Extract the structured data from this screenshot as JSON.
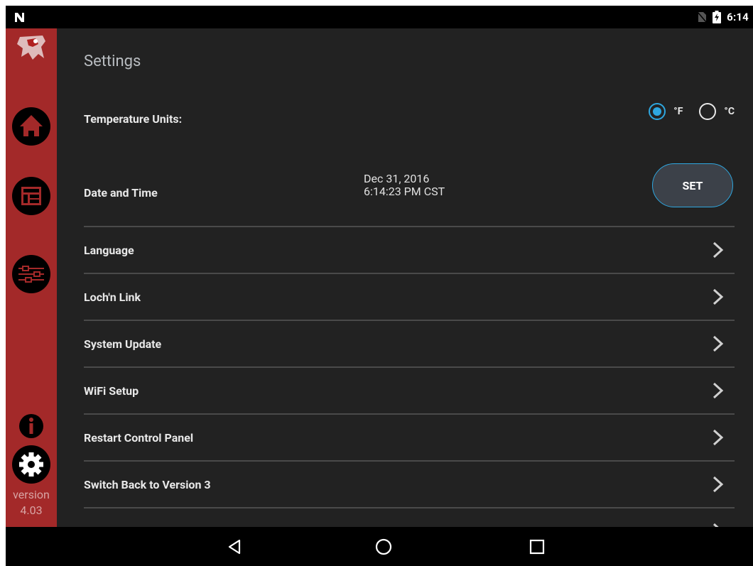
{
  "status_bar": {
    "time": "6:14",
    "icons": [
      "n-logo-icon",
      "no-sim-icon",
      "battery-charging-icon"
    ]
  },
  "sidebar": {
    "items": [
      {
        "icon": "logo-icon"
      },
      {
        "icon": "home-icon"
      },
      {
        "icon": "dashboard-icon"
      },
      {
        "icon": "sliders-icon"
      },
      {
        "icon": "info-icon"
      },
      {
        "icon": "gear-icon"
      }
    ],
    "version_label": "version",
    "version_number": "4.03"
  },
  "settings": {
    "title": "Settings",
    "temperature": {
      "label": "Temperature Units:",
      "options": [
        "°F",
        "°C"
      ],
      "selected": "°F"
    },
    "date_time": {
      "label": "Date and Time",
      "date": "Dec 31, 2016",
      "time": "6:14:23 PM CST",
      "set_label": "SET"
    },
    "menu_items": [
      "Language",
      "Loch'n Link",
      "System Update",
      "WiFi Setup",
      "Restart Control Panel",
      "Switch Back to Version 3"
    ]
  },
  "nav_bar": {
    "buttons": [
      "back-icon",
      "home-circle-icon",
      "recents-icon"
    ]
  },
  "colors": {
    "sidebar": "#a32929",
    "background": "#222222",
    "accent": "#2ea7e0"
  }
}
